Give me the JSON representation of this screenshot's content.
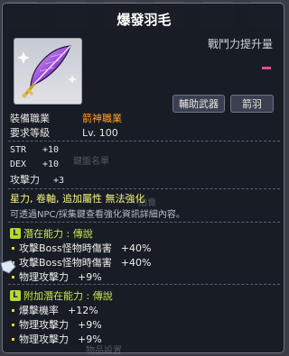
{
  "item": {
    "name": "爆發羽毛",
    "power_up": "戰鬥力提升量",
    "tags": [
      "輔助武器",
      "箭羽"
    ],
    "job_label": "裝備職業",
    "job_value": "箭神職業",
    "level_label": "要求等級",
    "level_value": "Lv. 100"
  },
  "stats": [
    {
      "label": "STR",
      "value": "+10"
    },
    {
      "label": "DEX",
      "value": "+10"
    },
    {
      "label": "攻擊力",
      "value": "+3"
    }
  ],
  "notes": {
    "restrictions": "星力, 卷軸, 追加屬性 無法強化",
    "npc_hint": "可透過NPC/採集鍵查看強化資訊詳細內容。"
  },
  "potential": {
    "header": "潛在能力 : 傳說",
    "badge": "L",
    "lines": [
      {
        "text": "攻擊Boss怪物時傷害",
        "value": "+40%"
      },
      {
        "text": "攻擊Boss怪物時傷害",
        "value": "+40%"
      },
      {
        "text": "物理攻擊力",
        "value": "+9%"
      }
    ]
  },
  "bonus_potential": {
    "header": "附加潛在能力 : 傳說",
    "badge": "L",
    "lines": [
      {
        "text": "爆擊機率",
        "value": "+12%"
      },
      {
        "text": "物理攻擊力",
        "value": "+9%"
      },
      {
        "text": "物理攻擊力",
        "value": "+9%"
      }
    ]
  },
  "background": {
    "ghost_1": "鍵盤名單",
    "ghost_2": "拍賣",
    "ghost_3": "物品設置"
  },
  "colors": {
    "job_value": "#ff9f2e",
    "potential_header": "#c8ea4c",
    "notes": "#f7f780"
  }
}
